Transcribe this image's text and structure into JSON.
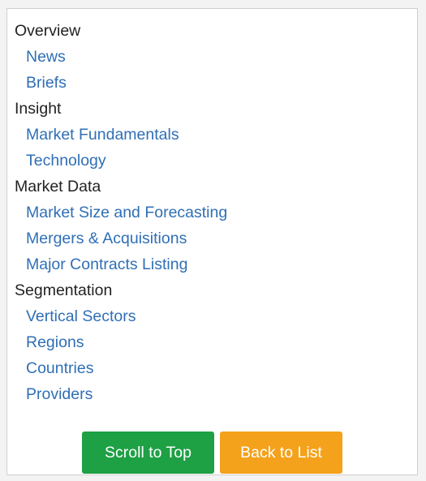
{
  "sections": [
    {
      "heading": "Overview",
      "links": [
        "News",
        "Briefs"
      ]
    },
    {
      "heading": "Insight",
      "links": [
        "Market Fundamentals",
        "Technology"
      ]
    },
    {
      "heading": "Market Data",
      "links": [
        "Market Size and Forecasting",
        "Mergers & Acquisitions",
        "Major Contracts Listing"
      ]
    },
    {
      "heading": "Segmentation",
      "links": [
        "Vertical Sectors",
        "Regions",
        "Countries",
        "Providers"
      ]
    }
  ],
  "buttons": {
    "scroll_top_label": "Scroll to Top",
    "back_list_label": "Back to List"
  },
  "colors": {
    "link": "#2f6fb5",
    "scroll_top_bg": "#1ea045",
    "back_list_bg": "#f4a21b"
  }
}
